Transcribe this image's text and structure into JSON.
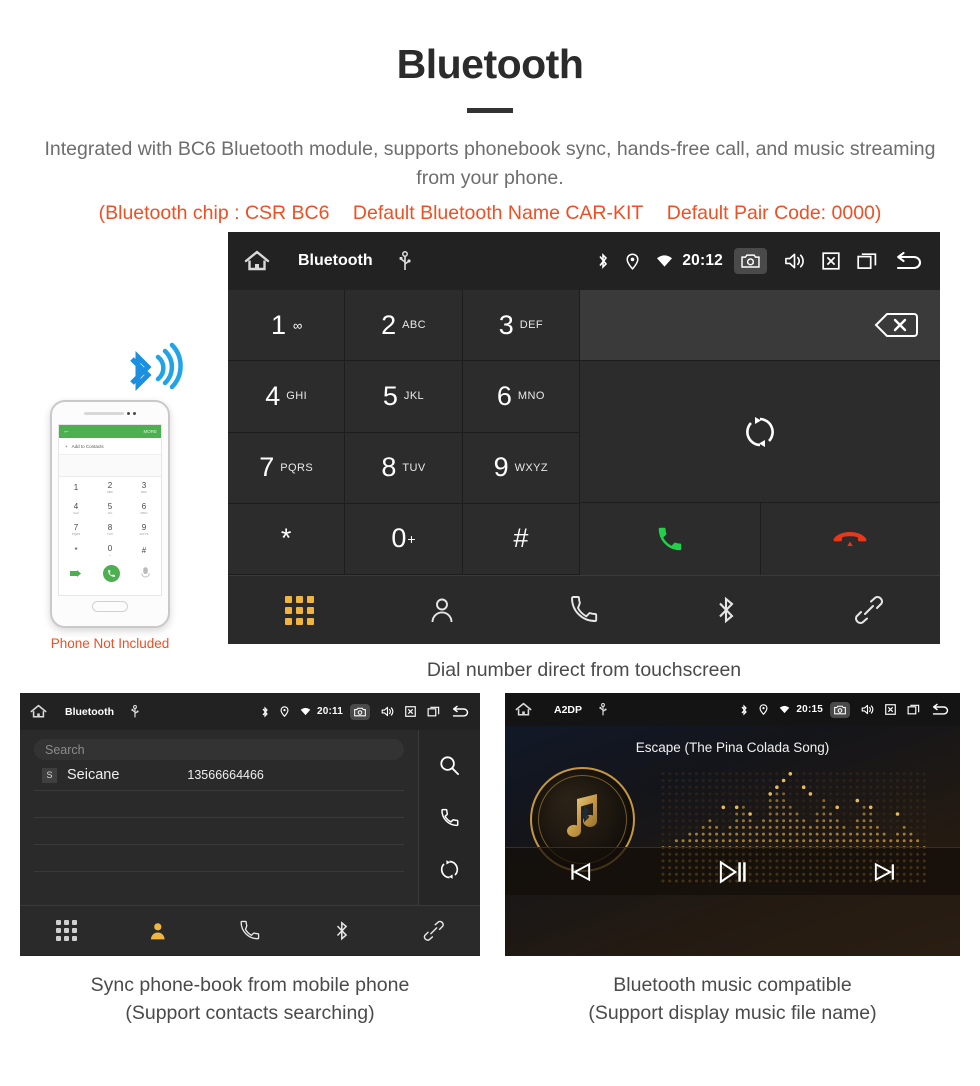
{
  "header": {
    "title": "Bluetooth",
    "subtitle": "Integrated with BC6 Bluetooth module, supports phonebook sync, hands-free call, and music streaming from your phone.",
    "specs_open": "(Bluetooth chip : CSR BC6",
    "specs_name": "Default Bluetooth Name CAR-KIT",
    "specs_code": "Default Pair Code: 0000)",
    "accent_color": "#f04e23"
  },
  "phone_mock": {
    "back_label": "←",
    "more_label": "MORE",
    "add_contact_label": "Add to Contacts",
    "keys": [
      {
        "num": "1",
        "sub": ""
      },
      {
        "num": "2",
        "sub": "ABC"
      },
      {
        "num": "3",
        "sub": "DEF"
      },
      {
        "num": "4",
        "sub": "GHI"
      },
      {
        "num": "5",
        "sub": "JKL"
      },
      {
        "num": "6",
        "sub": "MNO"
      },
      {
        "num": "7",
        "sub": "PQRS"
      },
      {
        "num": "8",
        "sub": "TUV"
      },
      {
        "num": "9",
        "sub": "WXYZ"
      },
      {
        "num": "*",
        "sub": ""
      },
      {
        "num": "0",
        "sub": "+"
      },
      {
        "num": "#",
        "sub": ""
      }
    ],
    "not_included_note": "Phone Not Included"
  },
  "dialer": {
    "status": {
      "title": "Bluetooth",
      "time": "20:12",
      "home_icon": "home-icon",
      "usb_icon": "usb-icon",
      "bluetooth_icon": "bluetooth-icon",
      "location_icon": "location-pin-icon",
      "wifi_icon": "wifi-icon",
      "camera_icon": "camera-icon",
      "volume_icon": "volume-icon",
      "close_icon": "close-box-icon",
      "recents_icon": "recents-icon",
      "back_icon": "back-arrow-icon"
    },
    "keys": [
      {
        "num": "1",
        "sub": "",
        "voicemail": "∞"
      },
      {
        "num": "2",
        "sub": "ABC"
      },
      {
        "num": "3",
        "sub": "DEF"
      },
      {
        "num": "4",
        "sub": "GHI"
      },
      {
        "num": "5",
        "sub": "JKL"
      },
      {
        "num": "6",
        "sub": "MNO"
      },
      {
        "num": "7",
        "sub": "PQRS"
      },
      {
        "num": "8",
        "sub": "TUV"
      },
      {
        "num": "9",
        "sub": "WXYZ"
      },
      {
        "num": "*",
        "sub": ""
      },
      {
        "num": "0",
        "sup": "+"
      },
      {
        "num": "#",
        "sub": ""
      }
    ],
    "number_value": "",
    "backspace_icon": "backspace-icon",
    "sync_icon": "sync-icon",
    "call_icon": "call-icon",
    "hangup_icon": "hangup-icon",
    "call_color": "#22d04a",
    "hangup_color": "#e8381b",
    "nav": [
      {
        "name": "dialpad",
        "icon": "dialpad-icon",
        "active": true
      },
      {
        "name": "contacts",
        "icon": "person-icon",
        "active": false
      },
      {
        "name": "call-log",
        "icon": "handset-icon",
        "active": false
      },
      {
        "name": "bluetooth",
        "icon": "bluetooth-icon",
        "active": false
      },
      {
        "name": "link",
        "icon": "link-icon",
        "active": false
      }
    ],
    "active_color": "#f0b440",
    "caption": "Dial number direct from touchscreen"
  },
  "contacts": {
    "status": {
      "title": "Bluetooth",
      "time": "20:11"
    },
    "search_placeholder": "Search",
    "rows": [
      {
        "initial": "S",
        "name": "Seicane",
        "number": "13566664466"
      }
    ],
    "rail": [
      {
        "name": "search",
        "icon": "search-icon"
      },
      {
        "name": "call",
        "icon": "handset-icon"
      },
      {
        "name": "sync",
        "icon": "sync-icon"
      }
    ],
    "nav": [
      {
        "name": "dialpad",
        "icon": "dialpad-icon",
        "active": false
      },
      {
        "name": "contacts",
        "icon": "person-icon",
        "active": true
      },
      {
        "name": "call-log",
        "icon": "handset-icon",
        "active": false
      },
      {
        "name": "bluetooth",
        "icon": "bluetooth-icon",
        "active": false
      },
      {
        "name": "link",
        "icon": "link-icon",
        "active": false
      }
    ],
    "caption_line1": "Sync phone-book from mobile phone",
    "caption_line2": "(Support contacts searching)"
  },
  "music": {
    "status": {
      "title": "A2DP",
      "time": "20:15"
    },
    "track_title": "Escape (The Pina Colada Song)",
    "art_icon": "music-note-bluetooth-icon",
    "controls": [
      {
        "name": "previous",
        "icon": "previous-track-icon"
      },
      {
        "name": "play-pause",
        "icon": "play-pause-icon"
      },
      {
        "name": "next",
        "icon": "next-track-icon"
      }
    ],
    "accent_color": "#c59840",
    "caption_line1": "Bluetooth music compatible",
    "caption_line2": "(Support display music file name)"
  }
}
